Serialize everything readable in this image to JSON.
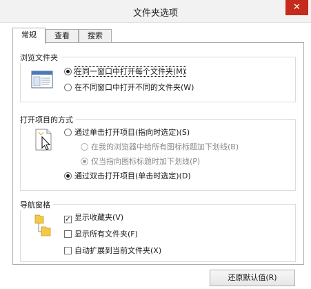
{
  "window": {
    "title": "文件夹选项",
    "close_glyph": "✕"
  },
  "tabs": [
    {
      "label": "常规",
      "active": true
    },
    {
      "label": "查看",
      "active": false
    },
    {
      "label": "搜索",
      "active": false
    }
  ],
  "browse_folders": {
    "label": "浏览文件夹",
    "icon": "window-icon",
    "options": [
      {
        "label": "在同一窗口中打开每个文件夹(M)",
        "checked": true
      },
      {
        "label": "在不同窗口中打开不同的文件夹(W)",
        "checked": false
      }
    ]
  },
  "click_items": {
    "label": "打开项目的方式",
    "icon": "cursor-hand-icon",
    "single_click": {
      "label": "通过单击打开项目(指向时选定)(S)",
      "checked": false
    },
    "underline_options": [
      {
        "label": "在我的浏览器中给所有图标标题加下划线(B)",
        "checked": false,
        "enabled": false
      },
      {
        "label": "仅当指向图标标题时加下划线(P)",
        "checked": true,
        "enabled": false
      }
    ],
    "double_click": {
      "label": "通过双击打开项目(单击时选定)(D)",
      "checked": true
    }
  },
  "navigation_pane": {
    "label": "导航窗格",
    "icon": "folder-tree-icon",
    "options": [
      {
        "label": "显示收藏夹(V)",
        "checked": true
      },
      {
        "label": "显示所有文件夹(F)",
        "checked": false
      },
      {
        "label": "自动扩展到当前文件夹(X)",
        "checked": false
      }
    ]
  },
  "footer": {
    "restore_defaults": "还原默认值(R)"
  },
  "colors": {
    "close_button": "#c42b1c",
    "border": "#adadad",
    "disabled_text": "#8a8a8a"
  }
}
